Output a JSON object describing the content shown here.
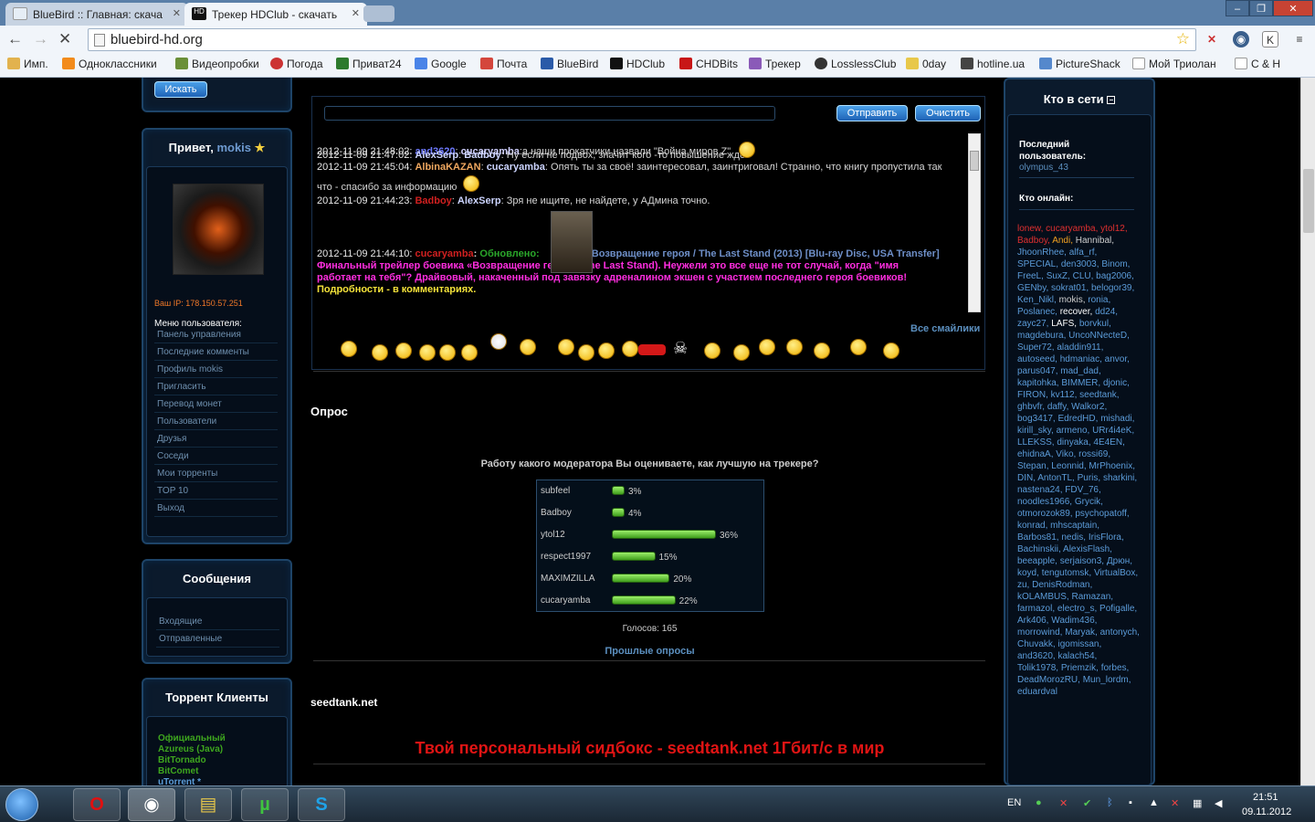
{
  "browser": {
    "tabs": [
      {
        "title": "BlueBird :: Главная: скача",
        "active": false
      },
      {
        "title": "Трекер HDClub - скачать",
        "active": true
      }
    ],
    "url": "bluebird-hd.org",
    "bookmarks": [
      "Имп.",
      "Одноклассники",
      "Видеопробки",
      "Погода",
      "Приват24",
      "Google",
      "Почта",
      "BlueBird",
      "HDClub",
      "CHDBits",
      "Трекер",
      "LosslessClub",
      "0day",
      "hotline.ua",
      "PictureShack",
      "Мой Триолан",
      "С & Н"
    ]
  },
  "left": {
    "search_btn": "Искать",
    "greeting": "Привет,",
    "username": "mokis",
    "ip": "Ваш IP: 178.150.57.251",
    "menu_title": "Меню пользователя:",
    "menu": [
      "Панель управления",
      "Последние комменты",
      "Профиль mokis",
      "Пригласить",
      "Перевод монет",
      "Пользователи",
      "Друзья",
      "Соседи",
      "Мои торренты",
      "TOP 10",
      "Выход"
    ],
    "messages_title": "Сообщения",
    "messages": [
      "Входящие",
      "Отправленные"
    ],
    "clients_title": "Торрент Клиенты",
    "clients": [
      "Официальный",
      "Azureus (Java)",
      "BitTornado",
      "BitComet",
      "uTorrent *"
    ]
  },
  "shoutbox": {
    "send_btn": "Отправить",
    "clear_btn": "Очистить",
    "all_smileys": "Все смайлики",
    "messages": [
      {
        "time": "2012-11-09 21:48:02:",
        "user": "and3620",
        "to": "cucaryamba",
        "text": "а наши прокатчики назвали \"Война миров Z\""
      },
      {
        "time": "2012-11-09 21:47:02:",
        "user": "AlexSerp",
        "to": "Badboy",
        "text": "Ну если не подвох, значит кого -то повышение ждёт"
      },
      {
        "time": "2012-11-09 21:45:04:",
        "user": "AlbinaKAZAN",
        "to": "cucaryamba",
        "text": "Опять ты за своё! заинтересовал, заинтриговал! Странно, что книгу пропустила так что - спасибо за информацию"
      },
      {
        "time": "2012-11-09 21:44:23:",
        "user": "Badboy",
        "to": "AlexSerp",
        "text": "Зря не ищите, не найдете, у АДмина точно."
      },
      {
        "time": "2012-11-09 21:44:10:",
        "user": "cucaryamba",
        "label": "Обновлено:",
        "title": "Возвращение героя / The Last Stand (2013) [Blu-ray Disc, USA Transfer]",
        "pink": "Финальный трейлер боевика «Возвращение героя» (The Last Stand). Неужели это все еще не тот случай, когда \"имя работает на тебя\"? Драйвовый, накаченный под завязку адреналином экшен с участием последнего героя боевиков!",
        "more": "Подробности - в комментариях."
      }
    ]
  },
  "poll": {
    "heading": "Опрос",
    "question": "Работу какого модератора Вы оцениваете, как лучшую на трекере?",
    "options": [
      {
        "name": "subfeel",
        "pct": 3,
        "label": "3%"
      },
      {
        "name": "Badboy",
        "pct": 4,
        "label": "4%"
      },
      {
        "name": "ytol12",
        "pct": 36,
        "label": "36%"
      },
      {
        "name": "respect1997",
        "pct": 15,
        "label": "15%"
      },
      {
        "name": "MAXIMZILLA",
        "pct": 20,
        "label": "20%"
      },
      {
        "name": "cucaryamba",
        "pct": 22,
        "label": "22%"
      }
    ],
    "votes": "Голосов: 165",
    "past": "Прошлые опросы"
  },
  "ad": {
    "heading": "seedtank.net",
    "text": "Твой персональный сидбокс - seedtank.net 1Гбит/с в мир"
  },
  "right": {
    "title": "Кто в сети",
    "last_label": "Последний пользователь:",
    "last_user": "olympus_43",
    "online_label": "Кто онлайн:",
    "online_users": "lonew, cucaryamba, ytol12, Badboy, Andi, Hannibal, JhoonRhee, alfa_rf, SPECIAL, den3003, Binom, FreeL, SuxZ, CLU, bag2006, GENby, sokrat01, belogor39, Ken_Nikl, mokis, ronia, Poslanec, recover, dd24, zayc27, LAFS, borvkul, magdebura, UncoNNecteD, Super72, aladdin911, autoseed, hdmaniac, anvor, parus047, mad_dad, kapitohka, BIMMER, djonic, FIRON, kv112, seedtank, ghbvfr, daffy, Walkor2, bog3417, EdredHD, mishadi, kirill_sky, armeno, URr4i4eK, LLEKSS, dinyaka, 4E4EN, ehidnaA, Viko, rossi69, Stepan, Leonnid, MrPhoenix, DIN, AntonTL, Puris, sharkini, nastena24, FDV_76, noodles1966, Grycik, otmorozok89, psychopatoff, konrad, mhscaptain, Barbos81, nedis, IrisFlora, Bachinskii, AlexisFlash, beeapple, serjaison3, Дрюн, koyd, tengutomsk, VirtualBox, zu, DenisRodman, kOLAMBUS, Ramazan, farmazol, electro_s, Pofigalle, Ark406, Wadim436, morrowind, Maryak, antonych, Chuvakk, igomissan, and3620, kalach54, Tolik1978, Priemzik, forbes, DeadMorozRU, Mun_lordm, eduardval"
  },
  "taskbar": {
    "lang": "EN",
    "time": "21:51",
    "date": "09.11.2012"
  }
}
